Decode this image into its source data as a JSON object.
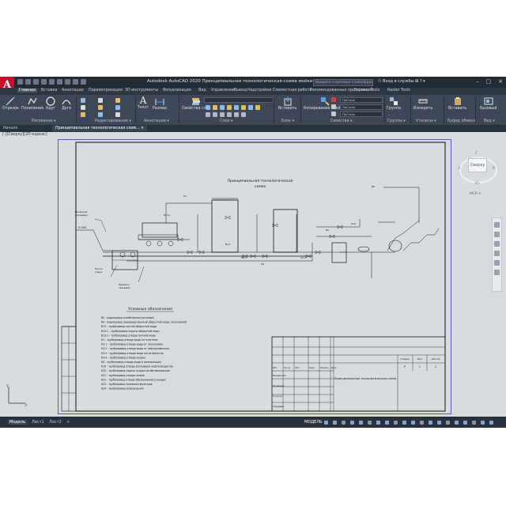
{
  "window": {
    "app_title": "Autodesk AutoCAD 2020   Принципиальная технологическая схема мойки машин.dwg",
    "search_placeholder": "Введите ключевое слово/фразу",
    "user": "Вход в службы"
  },
  "ribbon_tabs": [
    "Главная",
    "Вставка",
    "Аннотации",
    "Параметризация",
    "3D инструменты",
    "Визуализация",
    "Вид",
    "Управление",
    "Вывод",
    "Надстройки",
    "Совместная работа",
    "Рекомендованные приложения",
    "Express Tools",
    "Raster Tools"
  ],
  "ribbon": {
    "draw": {
      "line": "Отрезок",
      "polyline": "Полилиния",
      "circle": "Круг",
      "arc": "Дуга",
      "panel": "Рисование ▾"
    },
    "modify": {
      "panel": "Редактирование ▾"
    },
    "annotation": {
      "text": "Текст",
      "dimension": "Размер",
      "panel": "Аннотации ▾"
    },
    "layers": {
      "layer_props": "Свойства слоя",
      "panel": "Слои ▾"
    },
    "block": {
      "insert": "Вставить",
      "panel": "Блок ▾"
    },
    "properties": {
      "match": "Копирование свойств",
      "bylayer1": "ПоСлою",
      "bylayer2": "ПоСлою",
      "bylayer3": "ПоСлою",
      "panel": "Свойства ▾"
    },
    "groups": {
      "group": "Группа",
      "panel": "Группы ▾"
    },
    "utilities": {
      "measure": "Измерить",
      "panel": "Утилиты ▾"
    },
    "clipboard": {
      "paste": "Вставить",
      "panel": "Буфер обмена"
    },
    "view": {
      "base": "Базовый",
      "panel": "Вид ▾"
    }
  },
  "doc_tabs": {
    "start": "Начало",
    "file": "Принципиальная технологическая схем..."
  },
  "viewport": {
    "label": "[-][Сверху][2D-каркас]"
  },
  "viewcube": {
    "face": "Сверху",
    "ucs": "МСК ▾",
    "north": "С",
    "south": "Ю",
    "west": "З",
    "east": "В"
  },
  "drawing": {
    "title_line1": "Принципиальная технологическая",
    "title_line2": "схема",
    "legend_title": "Условные обозначения",
    "legend": [
      "В0 - водопровод хозяйственно-питьевой",
      "В4 - водопровод производственный оборотной воды, получаемой",
      "В13 - трубопровод чистой оборотной воды",
      "В13.1 - трубопровод подачи оборотной воды",
      "В13.2 - трубопровод отвода грязной воды",
      "К1 - трубопровод отвода воды на очистные",
      "К3.1 - трубопровод отвода воды от песколовки",
      "К3.2 - трубопровод отвода воды от нефтеуловителя",
      "К3.3 - трубопровод отвода воды после фильтра",
      "К3.4 - трубопровод отвода осадка",
      "К4 - трубопровод отвода воды в канализацию",
      "К19 - трубопровод отвода всплывших нефтепродуктов",
      "К20 - трубопровод подачи осадка на обезвоживание",
      "К21 - трубопровод отвода шлама",
      "К22 - трубопровод отвода обезвоженного осадка",
      "К23 - трубопровод промывки фильтров",
      "К24 - трубопровод опорожнения"
    ],
    "tb_main": "Принципиальная технологическая схема",
    "tb_cols": [
      "Стадия",
      "Лист",
      "Листов"
    ],
    "tb_vals": [
      "Р",
      "1",
      "2"
    ],
    "tb_rows": [
      "Разработал",
      "Проверил",
      "Н.контр.",
      "Утвердил"
    ],
    "tb_heads": [
      "Изм.",
      "Кол.уч",
      "Лист",
      "№док.",
      "Подпись",
      "Дата"
    ],
    "elev": "0.000",
    "sump_label": "Песко-\nловка",
    "label_pit": "Приямок\nгрязевой"
  },
  "statusbar": {
    "model_tab": "Модель",
    "layout1": "Лист1",
    "layout2": "Лист2",
    "model_btn": "МОДЕЛЬ"
  }
}
